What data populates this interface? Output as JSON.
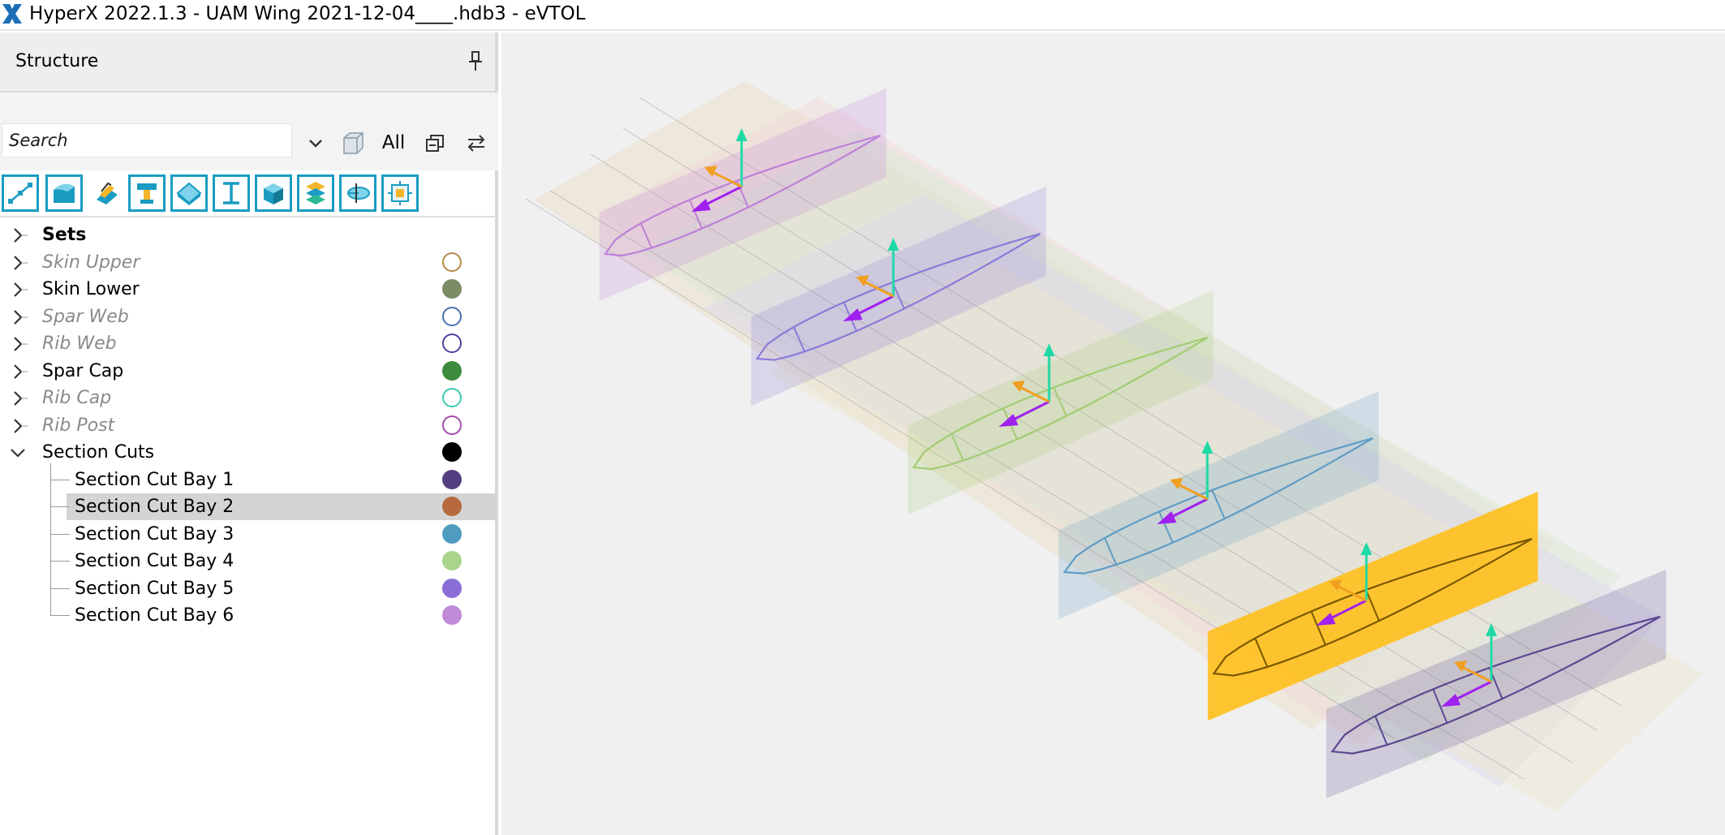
{
  "window": {
    "title": "HyperX 2022.1.3 - UAM Wing 2021-12-04____.hdb3 - eVTOL",
    "logo_icon": "hyperx-logo-icon",
    "accent": "#1a9cc2"
  },
  "panel": {
    "title": "Structure",
    "pin_icon": "pin-icon",
    "search": {
      "placeholder": "Search",
      "value": ""
    },
    "filter_all_label": "All",
    "toolbar_icons": [
      "joints-icon",
      "panel-icon",
      "ply-icon",
      "rib-icon",
      "plate-icon",
      "beam-icon",
      "solid-icon",
      "laminate-icon",
      "section-cut-icon",
      "fastener-icon"
    ]
  },
  "tree": {
    "items": [
      {
        "label": "Sets",
        "level": 0,
        "expander": "collapsed",
        "style": "bold",
        "color": null,
        "filled": false
      },
      {
        "label": "Skin Upper",
        "level": 0,
        "expander": "collapsed",
        "style": "hidden",
        "color": "#b5894a",
        "filled": false
      },
      {
        "label": "Skin Lower",
        "level": 0,
        "expander": "collapsed",
        "style": "normal",
        "color": "#7c8c64",
        "filled": true
      },
      {
        "label": "Spar Web",
        "level": 0,
        "expander": "collapsed",
        "style": "hidden",
        "color": "#4a6fae",
        "filled": false
      },
      {
        "label": "Rib Web",
        "level": 0,
        "expander": "collapsed",
        "style": "hidden",
        "color": "#4a44a0",
        "filled": false
      },
      {
        "label": "Spar Cap",
        "level": 0,
        "expander": "collapsed",
        "style": "normal",
        "color": "#3e8a3c",
        "filled": true
      },
      {
        "label": "Rib Cap",
        "level": 0,
        "expander": "collapsed",
        "style": "hidden",
        "color": "#3cc8b0",
        "filled": false
      },
      {
        "label": "Rib Post",
        "level": 0,
        "expander": "collapsed",
        "style": "hidden",
        "color": "#a34aa8",
        "filled": false
      },
      {
        "label": "Section Cuts",
        "level": 0,
        "expander": "expanded",
        "style": "normal",
        "color": "#000000",
        "filled": true
      },
      {
        "label": "Section Cut Bay 1",
        "level": 1,
        "expander": "none",
        "style": "normal",
        "color": "#543e82",
        "filled": true
      },
      {
        "label": "Section Cut Bay 2",
        "level": 1,
        "expander": "none",
        "style": "normal",
        "color": "#b8693e",
        "filled": true,
        "selected": true
      },
      {
        "label": "Section Cut Bay 3",
        "level": 1,
        "expander": "none",
        "style": "normal",
        "color": "#4f9cc0",
        "filled": true
      },
      {
        "label": "Section Cut Bay 4",
        "level": 1,
        "expander": "none",
        "style": "normal",
        "color": "#a8d48c",
        "filled": true
      },
      {
        "label": "Section Cut Bay 5",
        "level": 1,
        "expander": "none",
        "style": "normal",
        "color": "#8a6ed6",
        "filled": true
      },
      {
        "label": "Section Cut Bay 6",
        "level": 1,
        "expander": "none",
        "style": "normal",
        "color": "#c08ad8",
        "filled": true
      }
    ]
  },
  "viewport": {
    "background": "#f0f0f0",
    "model": "wing-3d-model",
    "section_cut_colors": [
      "#bd80d9",
      "#8a7ad8",
      "#a2cc72",
      "#5f9dc4",
      "#ffc020",
      "#5a4890"
    ],
    "highlighted_cut": "Section Cut Bay 2",
    "axis_colors": {
      "normal": "#1ed9a6",
      "chord": "#a020f0",
      "span": "#f0a020"
    }
  }
}
